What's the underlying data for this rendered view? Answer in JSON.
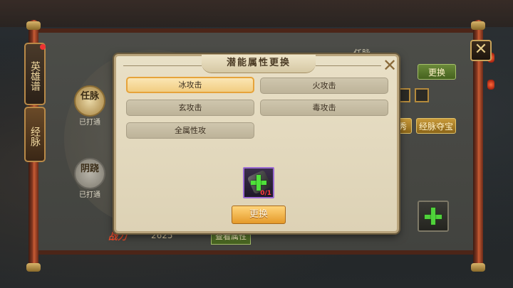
{
  "background": {
    "side_tabs": [
      {
        "label": "英雄谱",
        "active": false
      },
      {
        "label": "经脉",
        "active": true
      }
    ],
    "nodes": [
      {
        "label": "任脉",
        "status": "已打通"
      },
      {
        "label": "阴跷",
        "status": "已打通"
      }
    ],
    "right_title": "任脉",
    "replace_label": "更换",
    "treasure_label": "经脉夺宝",
    "partial_label": "秀",
    "power_label": "战力",
    "power_value": "2625",
    "view_attr_label": "查看属性",
    "close_glyph": "✕"
  },
  "modal": {
    "title": "潜能属性更换",
    "close_glyph": "✕",
    "options": [
      {
        "label": "冰攻击",
        "selected": true
      },
      {
        "label": "火攻击",
        "selected": false
      },
      {
        "label": "玄攻击",
        "selected": false
      },
      {
        "label": "毒攻击",
        "selected": false
      },
      {
        "label": "全属性攻",
        "selected": false
      }
    ],
    "material": {
      "count": "0/1",
      "icon": "plus-icon"
    },
    "confirm_label": "更换"
  },
  "colors": {
    "accent_gold": "#e6a33a",
    "material_border": "#9a6ad2",
    "plus_green": "#4fe23a",
    "shortage_red": "#ff3b3b"
  }
}
